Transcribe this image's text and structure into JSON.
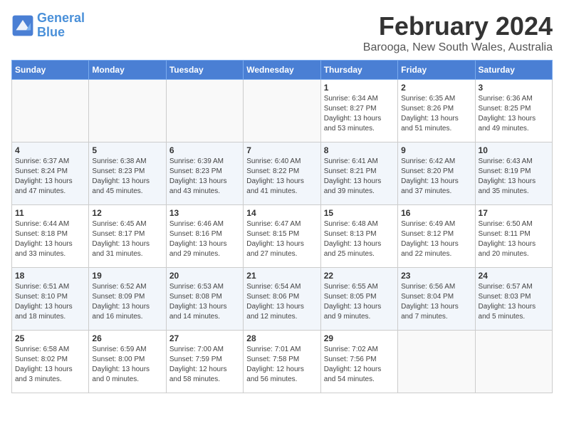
{
  "logo": {
    "line1": "General",
    "line2": "Blue"
  },
  "title": "February 2024",
  "subtitle": "Barooga, New South Wales, Australia",
  "days_of_week": [
    "Sunday",
    "Monday",
    "Tuesday",
    "Wednesday",
    "Thursday",
    "Friday",
    "Saturday"
  ],
  "weeks": [
    [
      {
        "day": "",
        "info": ""
      },
      {
        "day": "",
        "info": ""
      },
      {
        "day": "",
        "info": ""
      },
      {
        "day": "",
        "info": ""
      },
      {
        "day": "1",
        "info": "Sunrise: 6:34 AM\nSunset: 8:27 PM\nDaylight: 13 hours\nand 53 minutes."
      },
      {
        "day": "2",
        "info": "Sunrise: 6:35 AM\nSunset: 8:26 PM\nDaylight: 13 hours\nand 51 minutes."
      },
      {
        "day": "3",
        "info": "Sunrise: 6:36 AM\nSunset: 8:25 PM\nDaylight: 13 hours\nand 49 minutes."
      }
    ],
    [
      {
        "day": "4",
        "info": "Sunrise: 6:37 AM\nSunset: 8:24 PM\nDaylight: 13 hours\nand 47 minutes."
      },
      {
        "day": "5",
        "info": "Sunrise: 6:38 AM\nSunset: 8:23 PM\nDaylight: 13 hours\nand 45 minutes."
      },
      {
        "day": "6",
        "info": "Sunrise: 6:39 AM\nSunset: 8:23 PM\nDaylight: 13 hours\nand 43 minutes."
      },
      {
        "day": "7",
        "info": "Sunrise: 6:40 AM\nSunset: 8:22 PM\nDaylight: 13 hours\nand 41 minutes."
      },
      {
        "day": "8",
        "info": "Sunrise: 6:41 AM\nSunset: 8:21 PM\nDaylight: 13 hours\nand 39 minutes."
      },
      {
        "day": "9",
        "info": "Sunrise: 6:42 AM\nSunset: 8:20 PM\nDaylight: 13 hours\nand 37 minutes."
      },
      {
        "day": "10",
        "info": "Sunrise: 6:43 AM\nSunset: 8:19 PM\nDaylight: 13 hours\nand 35 minutes."
      }
    ],
    [
      {
        "day": "11",
        "info": "Sunrise: 6:44 AM\nSunset: 8:18 PM\nDaylight: 13 hours\nand 33 minutes."
      },
      {
        "day": "12",
        "info": "Sunrise: 6:45 AM\nSunset: 8:17 PM\nDaylight: 13 hours\nand 31 minutes."
      },
      {
        "day": "13",
        "info": "Sunrise: 6:46 AM\nSunset: 8:16 PM\nDaylight: 13 hours\nand 29 minutes."
      },
      {
        "day": "14",
        "info": "Sunrise: 6:47 AM\nSunset: 8:15 PM\nDaylight: 13 hours\nand 27 minutes."
      },
      {
        "day": "15",
        "info": "Sunrise: 6:48 AM\nSunset: 8:13 PM\nDaylight: 13 hours\nand 25 minutes."
      },
      {
        "day": "16",
        "info": "Sunrise: 6:49 AM\nSunset: 8:12 PM\nDaylight: 13 hours\nand 22 minutes."
      },
      {
        "day": "17",
        "info": "Sunrise: 6:50 AM\nSunset: 8:11 PM\nDaylight: 13 hours\nand 20 minutes."
      }
    ],
    [
      {
        "day": "18",
        "info": "Sunrise: 6:51 AM\nSunset: 8:10 PM\nDaylight: 13 hours\nand 18 minutes."
      },
      {
        "day": "19",
        "info": "Sunrise: 6:52 AM\nSunset: 8:09 PM\nDaylight: 13 hours\nand 16 minutes."
      },
      {
        "day": "20",
        "info": "Sunrise: 6:53 AM\nSunset: 8:08 PM\nDaylight: 13 hours\nand 14 minutes."
      },
      {
        "day": "21",
        "info": "Sunrise: 6:54 AM\nSunset: 8:06 PM\nDaylight: 13 hours\nand 12 minutes."
      },
      {
        "day": "22",
        "info": "Sunrise: 6:55 AM\nSunset: 8:05 PM\nDaylight: 13 hours\nand 9 minutes."
      },
      {
        "day": "23",
        "info": "Sunrise: 6:56 AM\nSunset: 8:04 PM\nDaylight: 13 hours\nand 7 minutes."
      },
      {
        "day": "24",
        "info": "Sunrise: 6:57 AM\nSunset: 8:03 PM\nDaylight: 13 hours\nand 5 minutes."
      }
    ],
    [
      {
        "day": "25",
        "info": "Sunrise: 6:58 AM\nSunset: 8:02 PM\nDaylight: 13 hours\nand 3 minutes."
      },
      {
        "day": "26",
        "info": "Sunrise: 6:59 AM\nSunset: 8:00 PM\nDaylight: 13 hours\nand 0 minutes."
      },
      {
        "day": "27",
        "info": "Sunrise: 7:00 AM\nSunset: 7:59 PM\nDaylight: 12 hours\nand 58 minutes."
      },
      {
        "day": "28",
        "info": "Sunrise: 7:01 AM\nSunset: 7:58 PM\nDaylight: 12 hours\nand 56 minutes."
      },
      {
        "day": "29",
        "info": "Sunrise: 7:02 AM\nSunset: 7:56 PM\nDaylight: 12 hours\nand 54 minutes."
      },
      {
        "day": "",
        "info": ""
      },
      {
        "day": "",
        "info": ""
      }
    ]
  ]
}
